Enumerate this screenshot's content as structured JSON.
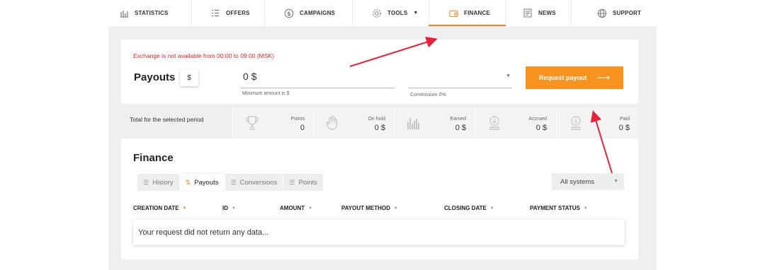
{
  "nav": {
    "items": [
      {
        "label": "STATISTICS",
        "icon": "bar-chart-icon"
      },
      {
        "label": "OFFERS",
        "icon": "list-icon"
      },
      {
        "label": "CAMPAIGNS",
        "icon": "dollar-circle-icon"
      },
      {
        "label": "TOOLS",
        "icon": "gear-icon"
      },
      {
        "label": "FINANCE",
        "icon": "wallet-icon",
        "active": true
      },
      {
        "label": "NEWS",
        "icon": "newspaper-icon"
      },
      {
        "label": "SUPPORT",
        "icon": "globe-icon"
      }
    ],
    "accent": "#f58220"
  },
  "payout_form": {
    "warning": "Exchange is not available from 00:00 to 09:00 (MSK)",
    "title": "Payouts",
    "currency": "$",
    "amount": "0 $",
    "amount_hint": "Minimum amount is $",
    "commission": "Commission 0%",
    "request_button": "Request payout",
    "button_color": "#f7931e",
    "warning_color": "#e1262c"
  },
  "totals": {
    "label": "Total for the selected period",
    "stats": [
      {
        "label": "Points",
        "value": "0",
        "icon": "trophy-icon"
      },
      {
        "label": "On hold",
        "value": "0 $",
        "icon": "hand-icon"
      },
      {
        "label": "Earned",
        "value": "0 $",
        "icon": "money-stack-icon"
      },
      {
        "label": "Accrued",
        "value": "0 $",
        "icon": "download-coin-icon"
      },
      {
        "label": "Paid",
        "value": "0 $",
        "icon": "coin-stack-icon"
      }
    ]
  },
  "finance": {
    "title": "Finance",
    "tabs": [
      {
        "label": "History",
        "icon": "menu-icon"
      },
      {
        "label": "Payouts",
        "icon": "sort-arrows-icon",
        "active": true
      },
      {
        "label": "Conversions",
        "icon": "menu-icon"
      },
      {
        "label": "Points",
        "icon": "menu-icon"
      }
    ],
    "systems_select": "All systems",
    "columns": [
      {
        "label": "CREATION DATE",
        "sorted": true
      },
      {
        "label": "ID"
      },
      {
        "label": "AMOUNT"
      },
      {
        "label": "PAYOUT METHOD"
      },
      {
        "label": "CLOSING DATE"
      },
      {
        "label": "PAYMENT STATUS"
      }
    ],
    "empty_message": "Your request did not return any data..."
  }
}
